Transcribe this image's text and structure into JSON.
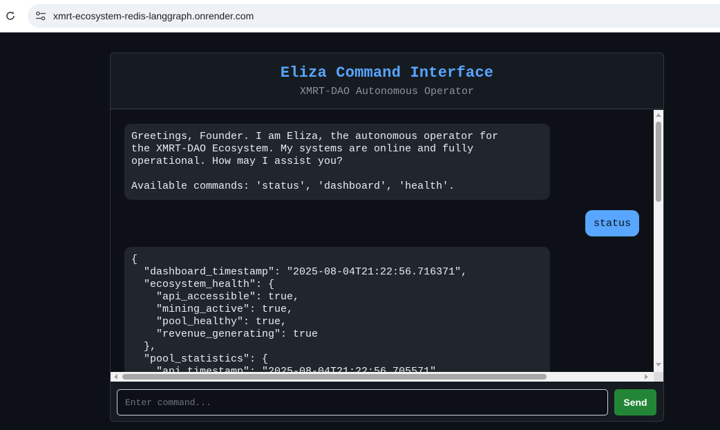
{
  "browser": {
    "url": "xmrt-ecosystem-redis-langgraph.onrender.com"
  },
  "header": {
    "title": "Eliza Command Interface",
    "subtitle": "XMRT-DAO Autonomous Operator"
  },
  "messages": {
    "greeting": "Greetings, Founder. I am Eliza, the autonomous operator for\nthe XMRT-DAO Ecosystem. My systems are online and fully\noperational. How may I assist you?\n\nAvailable commands: 'status', 'dashboard', 'health'.",
    "user_command": "status",
    "status_response": "{\n  \"dashboard_timestamp\": \"2025-08-04T21:22:56.716371\",\n  \"ecosystem_health\": {\n    \"api_accessible\": true,\n    \"mining_active\": true,\n    \"pool_healthy\": true,\n    \"revenue_generating\": true\n  },\n  \"pool_statistics\": {\n    \"api_timestamp\": \"2025-08-04T21:22:56.705571\","
  },
  "input": {
    "placeholder": "Enter command...",
    "value": ""
  },
  "actions": {
    "send_label": "Send"
  },
  "colors": {
    "accent": "#58a6ff",
    "send": "#238636",
    "background": "#0d1117",
    "panel": "#161b22"
  }
}
